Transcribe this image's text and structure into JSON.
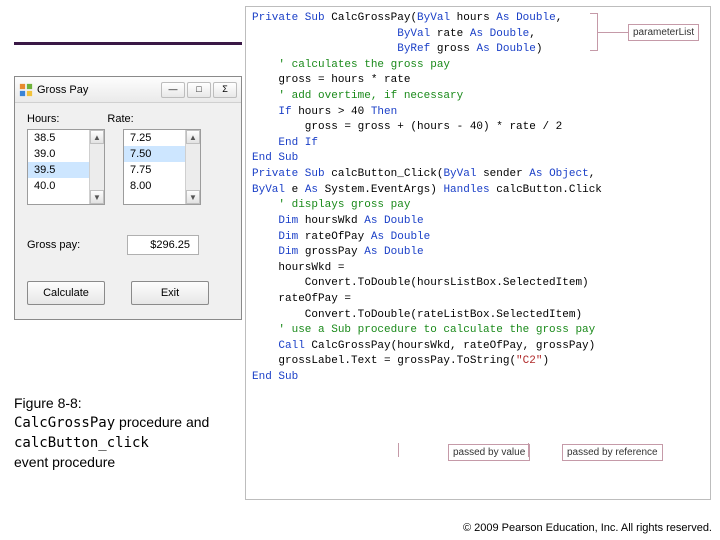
{
  "window": {
    "title": "Gross Pay",
    "minimize_glyph": "—",
    "maximize_glyph": "□",
    "close_glyph": "Σ",
    "labels": {
      "hours": "Hours:",
      "rate": "Rate:",
      "gross": "Gross pay:"
    },
    "hours_items": [
      "38.5",
      "39.0",
      "39.5",
      "40.0"
    ],
    "hours_selected_index": 2,
    "rate_items": [
      "7.25",
      "7.50",
      "7.75",
      "8.00"
    ],
    "rate_selected_index": 1,
    "gross_value": "$296.25",
    "buttons": {
      "calc": "Calculate",
      "exit": "Exit"
    },
    "scroll_up": "▲",
    "scroll_down": "▼"
  },
  "caption": {
    "fig": "Figure 8-8:",
    "mono1": "CalcGrossPay",
    "text1": " procedure and ",
    "mono2": "calcButton_click",
    "text2": " event procedure"
  },
  "callouts": {
    "paramlist": "parameterList",
    "byval": "passed by value",
    "byref": "passed by reference"
  },
  "chart_data": {
    "type": "table",
    "title": "Gross Pay listbox values",
    "series": [
      {
        "name": "Hours",
        "values": [
          38.5,
          39.0,
          39.5,
          40.0
        ],
        "selected": 39.5
      },
      {
        "name": "Rate",
        "values": [
          7.25,
          7.5,
          7.75,
          8.0
        ],
        "selected": 7.5
      }
    ],
    "output": {
      "label": "Gross pay",
      "value": 296.25,
      "format": "$0.00"
    }
  },
  "code": {
    "l01a": "Private Sub",
    "l01b": " CalcGrossPay(",
    "l01c": "ByVal",
    "l01d": " hours ",
    "l01e": "As Double",
    "l01f": ",",
    "l02a": "                      ",
    "l02b": "ByVal",
    "l02c": " rate ",
    "l02d": "As Double",
    "l02e": ",",
    "l03a": "                      ",
    "l03b": "ByRef",
    "l03c": " gross ",
    "l03d": "As Double",
    "l03e": ")",
    "l04a": "    ",
    "l04b": "' calculates the gross pay",
    "l05": "",
    "l06": "    gross = hours * rate",
    "l07a": "    ",
    "l07b": "' add overtime, if necessary",
    "l08a": "    ",
    "l08b": "If",
    "l08c": " hours > 40 ",
    "l08d": "Then",
    "l09": "        gross = gross + (hours - 40) * rate / 2",
    "l10a": "    ",
    "l10b": "End If",
    "l11": "End Sub",
    "l12": "",
    "l13a": "Private Sub",
    "l13b": " calcButton_Click(",
    "l13c": "ByVal",
    "l13d": " sender ",
    "l13e": "As Object",
    "l13f": ",",
    "l14a": "ByVal",
    "l14b": " e ",
    "l14c": "As",
    "l14d": " System.EventArgs) ",
    "l14e": "Handles",
    "l14f": " calcButton.Click",
    "l15a": "    ",
    "l15b": "' displays gross pay",
    "l16": "",
    "l17a": "    ",
    "l17b": "Dim",
    "l17c": " hoursWkd ",
    "l17d": "As Double",
    "l18a": "    ",
    "l18b": "Dim",
    "l18c": " rateOfPay ",
    "l18d": "As Double",
    "l19a": "    ",
    "l19b": "Dim",
    "l19c": " grossPay ",
    "l19d": "As Double",
    "l20": "",
    "l21": "    hoursWkd =",
    "l22": "        Convert.ToDouble(hoursListBox.SelectedItem)",
    "l23": "    rateOfPay =",
    "l24": "        Convert.ToDouble(rateListBox.SelectedItem)",
    "l25": "",
    "l26a": "    ",
    "l26b": "' use a Sub procedure to calculate the gross pay",
    "l27a": "    ",
    "l27b": "Call",
    "l27c": " CalcGrossPay(hoursWkd, rateOfPay, grossPay)",
    "l28": "",
    "l29": "",
    "l30": "",
    "l31a": "    grossLabel.Text = grossPay.ToString(",
    "l31b": "\"C2\"",
    "l31c": ")",
    "l32": "End Sub"
  },
  "footer": "© 2009 Pearson Education, Inc.  All rights reserved."
}
